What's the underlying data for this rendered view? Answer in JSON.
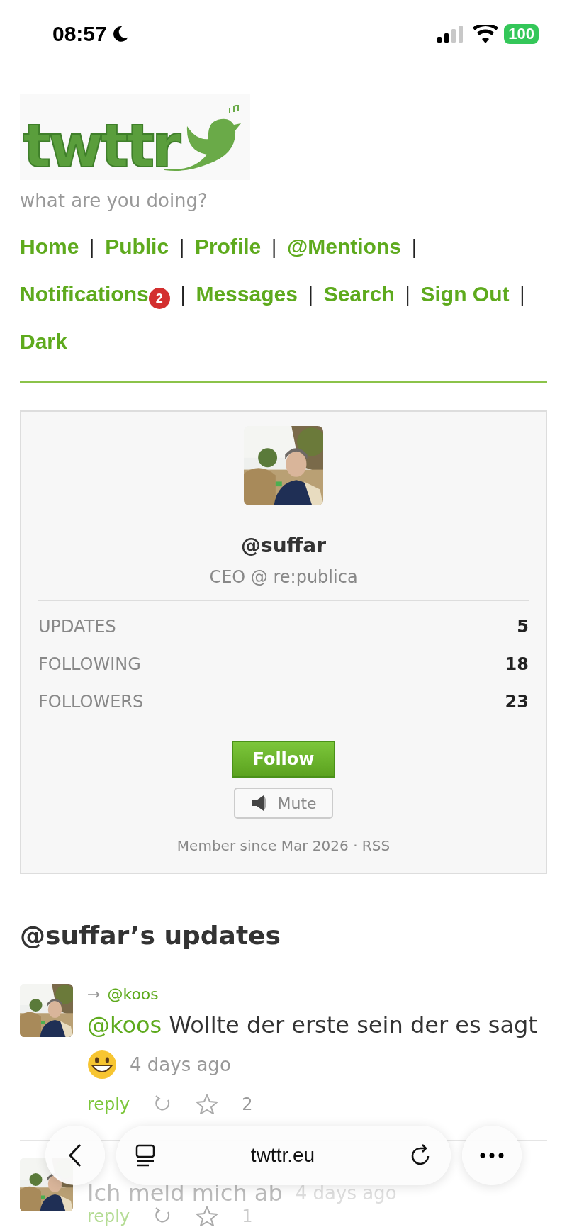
{
  "status_bar": {
    "time": "08:57",
    "battery": "100"
  },
  "header": {
    "logo": "twttr",
    "tagline": "what are you doing?",
    "separator": "|",
    "nav": [
      {
        "label": "Home"
      },
      {
        "label": "Public"
      },
      {
        "label": "Profile"
      },
      {
        "label": "@Mentions"
      },
      {
        "label": "Notifications",
        "badge": "2"
      },
      {
        "label": "Messages"
      },
      {
        "label": "Search"
      },
      {
        "label": "Sign Out"
      },
      {
        "label": "Dark"
      }
    ]
  },
  "profile": {
    "handle": "@suffar",
    "bio": "CEO @ re:publica",
    "stats": [
      {
        "label": "UPDATES",
        "value": "5"
      },
      {
        "label": "FOLLOWING",
        "value": "18"
      },
      {
        "label": "FOLLOWERS",
        "value": "23"
      }
    ],
    "follow_button": "Follow",
    "mute_button": "Mute",
    "member_since": "Member since Mar 2026",
    "dot": "·",
    "rss": "RSS"
  },
  "updates": {
    "heading": "@suffar’s updates",
    "items": [
      {
        "arrow": "→",
        "reply_to": "@koos",
        "mention": "@koos",
        "text": "Wollte der erste sein der es sagt",
        "emoji": true,
        "time": "4 days ago",
        "reply": "reply",
        "stars_count": "2"
      },
      {
        "text": "Ich meld mich ab",
        "emoji": false,
        "time": "4 days ago",
        "reply": "reply",
        "stars_count": "1"
      }
    ]
  },
  "browser_bar": {
    "url": "twttr.eu"
  }
}
